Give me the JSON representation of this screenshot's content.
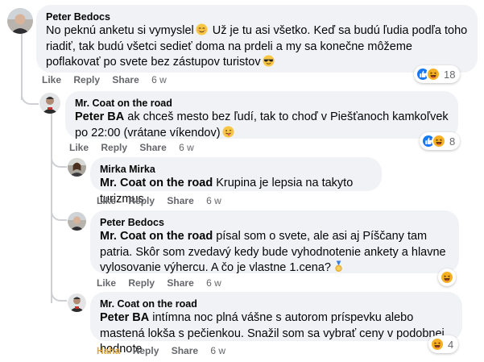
{
  "comments": [
    {
      "author": "Peter Bedocs",
      "text_1": "No peknú anketu si vymyslel",
      "emoji_1": "relieved-face-icon",
      "text_2": " Už je tu asi všetko. Keď sa budú ľudia podľa toho riadiť, tak budú všetci sedieť doma na prdeli a my sa konečne môžeme poflakovať po svete bez zástupov turistov",
      "emoji_2": "sunglasses-face-icon",
      "actions": {
        "like": "Like",
        "reply": "Reply",
        "share": "Share",
        "time": "6 w"
      },
      "reactions": {
        "icons": [
          "like",
          "haha"
        ],
        "count": "18"
      }
    },
    {
      "author": "Mr. Coat on the road",
      "mention": "Peter BA",
      "text": " ak chceš mesto bez ľudí, tak to choď v Piešťanoch kamkoľvek po 22:00 (vrátane víkendov)",
      "emoji": "winking-tongue-face-icon",
      "actions": {
        "like": "Like",
        "reply": "Reply",
        "share": "Share",
        "time": "6 w"
      },
      "reactions": {
        "icons": [
          "like",
          "haha"
        ],
        "count": "8"
      }
    },
    {
      "author": "Mirka Mirka",
      "mention": "Mr. Coat on the road",
      "text": " Krupina je lepsia na takyto turizmus",
      "actions": {
        "like": "Like",
        "reply": "Reply",
        "share": "Share",
        "time": "6 w"
      }
    },
    {
      "author": "Peter Bedocs",
      "mention": "Mr. Coat on the road",
      "text": " písal som o svete, ale asi aj Píščany tam patria. Skôr som zvedavý kedy bude vyhodnotenie ankety a hlavne vylosovanie výhercu. A čo je vlastne 1.cena?",
      "emoji": "medal-icon",
      "actions": {
        "like": "Like",
        "reply": "Reply",
        "share": "Share",
        "time": "6 w"
      },
      "reactions": {
        "icons": [
          "haha"
        ],
        "count": ""
      }
    },
    {
      "author": "Mr. Coat on the road",
      "mention": "Peter BA",
      "text": " intímna noc plná vášne s autorom príspevku alebo mastená lokša s pečienkou. Snažil som sa vybrať ceny v podobnej hodnote",
      "actions": {
        "like": "Haha",
        "reply": "Reply",
        "share": "Share",
        "time": "6 w"
      },
      "reactions": {
        "icons": [
          "haha"
        ],
        "count": "4"
      }
    }
  ],
  "colors": {
    "bubble": "#f0f2f5",
    "meta": "#65676b",
    "like_blue": "#1877f2",
    "haha_yellow": "#f7b125",
    "haha_active": "#e2a83d"
  }
}
